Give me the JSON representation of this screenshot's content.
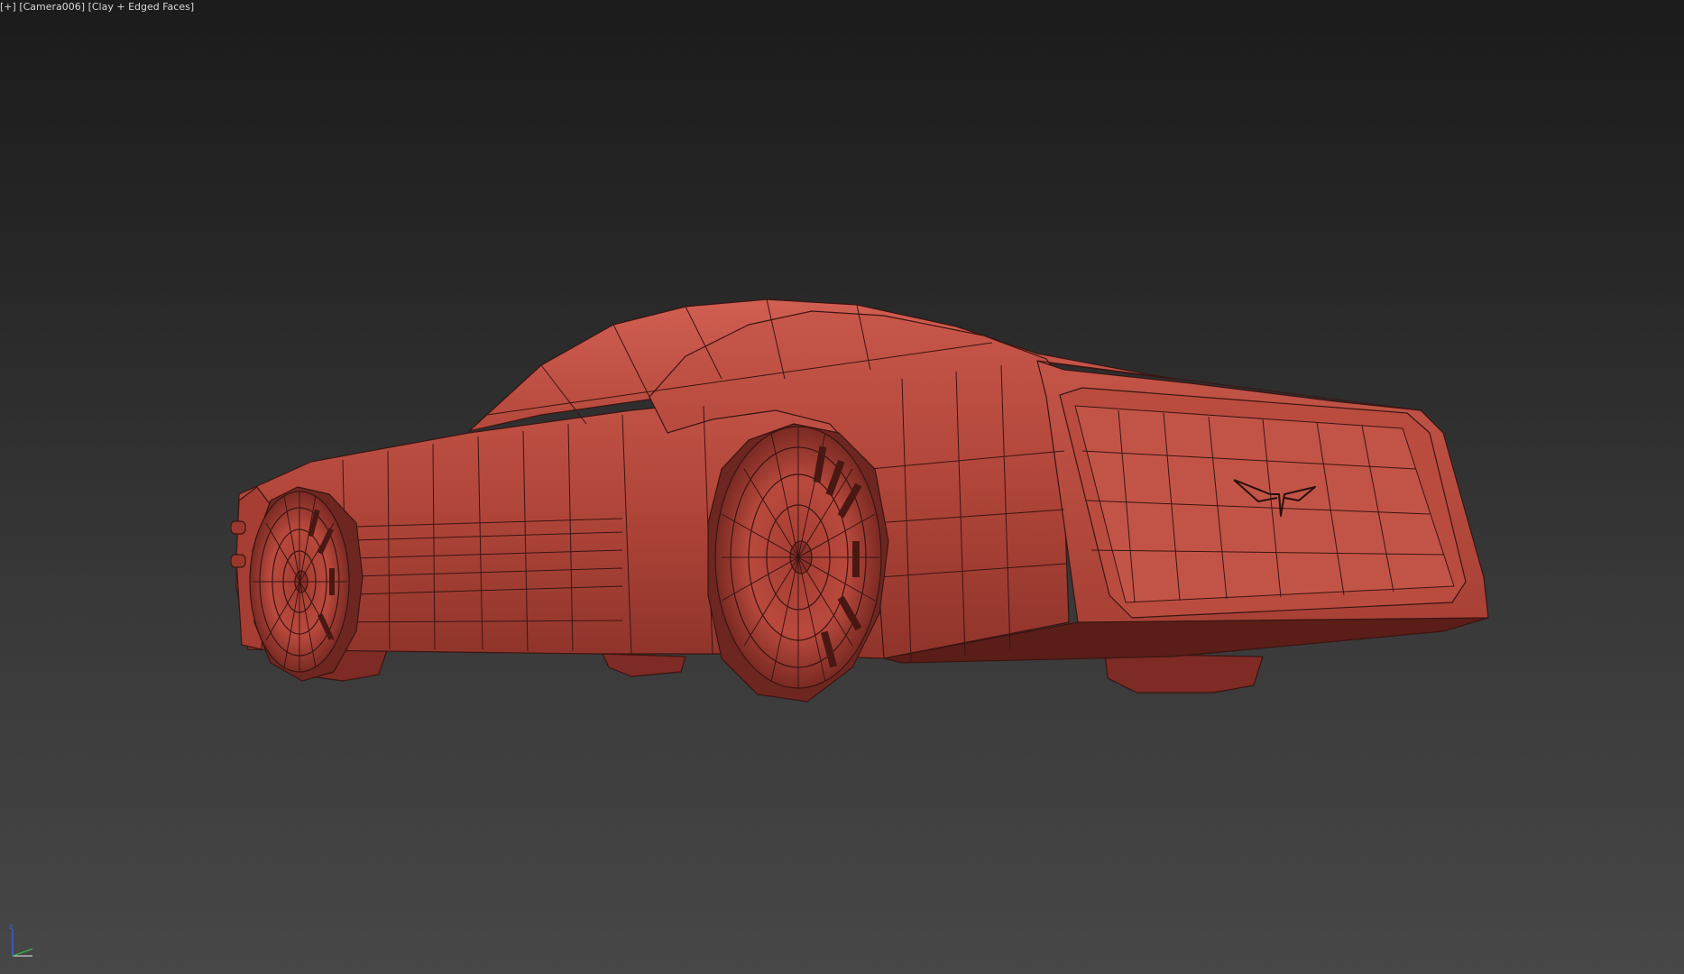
{
  "viewport": {
    "menu_label": "+",
    "camera_label": "Camera006",
    "shading_label": "Clay + Edged Faces"
  },
  "colors": {
    "background_top": "#1b1b1b",
    "background_bottom": "#474747",
    "clay": "#b5483d",
    "clay_light": "#c9574a",
    "clay_dark": "#6e2620",
    "edge_wire": "#3a1512",
    "axis_x": "#c8c8c8",
    "axis_y": "#39b54a",
    "axis_z": "#3a5bd9"
  },
  "scene": {
    "object_name": "car-model",
    "icons": [
      "view-axis-gizmo-icon",
      "emblem-icon"
    ]
  }
}
